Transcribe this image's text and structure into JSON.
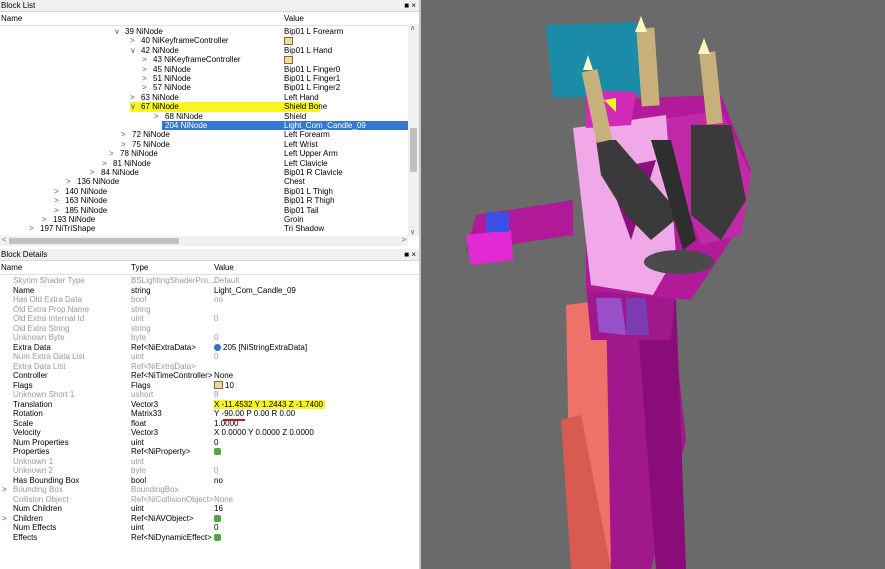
{
  "block_list": {
    "title": "Block List",
    "window_controls": "■ ×",
    "columns": {
      "name": "Name",
      "value": "Value"
    },
    "rows": [
      {
        "text": "39 NiNode",
        "value": "Bip01 L Forearm",
        "expander": "∨"
      },
      {
        "text": "40 NiKeyframeController",
        "value": "",
        "expander": ">"
      },
      {
        "text": "42 NiNode",
        "value": "Bip01 L Hand",
        "expander": "∨"
      },
      {
        "text": "43 NiKeyframeController",
        "value": "",
        "expander": ">"
      },
      {
        "text": "45 NiNode",
        "value": "Bip01 L Finger0",
        "expander": ">"
      },
      {
        "text": "51 NiNode",
        "value": "Bip01 L Finger1",
        "expander": ">"
      },
      {
        "text": "57 NiNode",
        "value": "Bip01 L Finger2",
        "expander": ">"
      },
      {
        "text": "63 NiNode",
        "value": "Left Hand",
        "expander": ">"
      },
      {
        "text": "67 NiNode",
        "value": "Shield Bone",
        "expander": "∨"
      },
      {
        "text": "68 NiNode",
        "value": "Shield",
        "expander": ">"
      },
      {
        "text": "204 NiNode",
        "value": "Light_Com_Candle_09",
        "expander": ""
      },
      {
        "text": "72 NiNode",
        "value": "Left Forearm",
        "expander": ">"
      },
      {
        "text": "75 NiNode",
        "value": "Left Wrist",
        "expander": ">"
      },
      {
        "text": "78 NiNode",
        "value": "Left Upper Arm",
        "expander": ">"
      },
      {
        "text": "81 NiNode",
        "value": "Left Clavicle",
        "expander": ">"
      },
      {
        "text": "84 NiNode",
        "value": "Bip01 R Clavicle",
        "expander": ">"
      },
      {
        "text": "136 NiNode",
        "value": "Chest",
        "expander": ">"
      },
      {
        "text": "140 NiNode",
        "value": "Bip01 L Thigh",
        "expander": ">"
      },
      {
        "text": "163 NiNode",
        "value": "Bip01 R Thigh",
        "expander": ">"
      },
      {
        "text": "185 NiNode",
        "value": "Bip01 Tail",
        "expander": ">"
      },
      {
        "text": "193 NiNode",
        "value": "Groin",
        "expander": ">"
      },
      {
        "text": "197 NiTriShape",
        "value": "Tri Shadow",
        "expander": ">"
      }
    ]
  },
  "block_details": {
    "title": "Block Details",
    "window_controls": "■ ×",
    "columns": {
      "name": "Name",
      "type": "Type",
      "value": "Value"
    },
    "rows": [
      {
        "name": "Skyrim Shader Type",
        "type": "BSLightingShaderPro...",
        "value": "Default",
        "gray": true
      },
      {
        "name": "Name",
        "type": "string",
        "value": "Light_Com_Candle_09",
        "gray": false
      },
      {
        "name": "Has Old Extra Data",
        "type": "bool",
        "value": "no",
        "gray": true
      },
      {
        "name": "Old Extra Prop Name",
        "type": "string",
        "value": "",
        "gray": true
      },
      {
        "name": "Old Extra Internal Id",
        "type": "uint",
        "value": "0",
        "gray": true
      },
      {
        "name": "Old Extra String",
        "type": "string",
        "value": "",
        "gray": true
      },
      {
        "name": "Unknown Byte",
        "type": "byte",
        "value": "0",
        "gray": true
      },
      {
        "name": "Extra Data",
        "type": "Ref<NiExtraData>",
        "value": "205 [NiStringExtraData]",
        "gray": false,
        "icon": "blue"
      },
      {
        "name": "Num Extra Data List",
        "type": "uint",
        "value": "0",
        "gray": true
      },
      {
        "name": "Extra Data List",
        "type": "Ref<NiExtraData>",
        "value": "",
        "gray": true
      },
      {
        "name": "Controller",
        "type": "Ref<NiTimeController>",
        "value": "None",
        "gray": false
      },
      {
        "name": "Flags",
        "type": "Flags",
        "value": "10",
        "gray": false,
        "icon": "flag"
      },
      {
        "name": "Unknown Short 1",
        "type": "ushort",
        "value": "8",
        "gray": true
      },
      {
        "name": "Translation",
        "type": "Vector3",
        "value": "X -11.4532 Y 1.2443 Z -1.7400",
        "gray": false,
        "highlight": true
      },
      {
        "name": "Rotation",
        "type": "Matrix33",
        "value": "Y -90.00 P 0.00 R 0.00",
        "gray": false
      },
      {
        "name": "Scale",
        "type": "float",
        "value": "1.0000",
        "gray": false
      },
      {
        "name": "Velocity",
        "type": "Vector3",
        "value": "X 0.0000 Y 0.0000 Z 0.0000",
        "gray": false
      },
      {
        "name": "Num Properties",
        "type": "uint",
        "value": "0",
        "gray": false
      },
      {
        "name": "Properties",
        "type": "Ref<NiProperty>",
        "value": "",
        "gray": false,
        "icon": "green"
      },
      {
        "name": "Unknown 1",
        "type": "uint",
        "value": "",
        "gray": true
      },
      {
        "name": "Unknown 2",
        "type": "byte",
        "value": "0",
        "gray": true
      },
      {
        "name": "Has Bounding Box",
        "type": "bool",
        "value": "no",
        "gray": false
      },
      {
        "name": "Bounding Box",
        "type": "BoundingBox",
        "value": "",
        "gray": true,
        "expander": ">"
      },
      {
        "name": "Collision Object",
        "type": "Ref<NiCollisionObject>",
        "value": "None",
        "gray": true
      },
      {
        "name": "Num Children",
        "type": "uint",
        "value": "16",
        "gray": false
      },
      {
        "name": "Children",
        "type": "Ref<NiAVObject>",
        "value": "",
        "gray": false,
        "icon": "green",
        "expander": ">"
      },
      {
        "name": "Num Effects",
        "type": "uint",
        "value": "0",
        "gray": false
      },
      {
        "name": "Effects",
        "type": "Ref<NiDynamicEffect>",
        "value": "",
        "gray": false,
        "icon": "green"
      }
    ]
  },
  "colors": {
    "selection": "#3478d4",
    "highlight": "#f8f520",
    "viewport_bg": "#6a6a6a",
    "body_magenta": "#a0188c",
    "torso_pink": "#f0a8e8",
    "leg_salmon": "#f0706a",
    "head_teal": "#1a8ca8"
  }
}
